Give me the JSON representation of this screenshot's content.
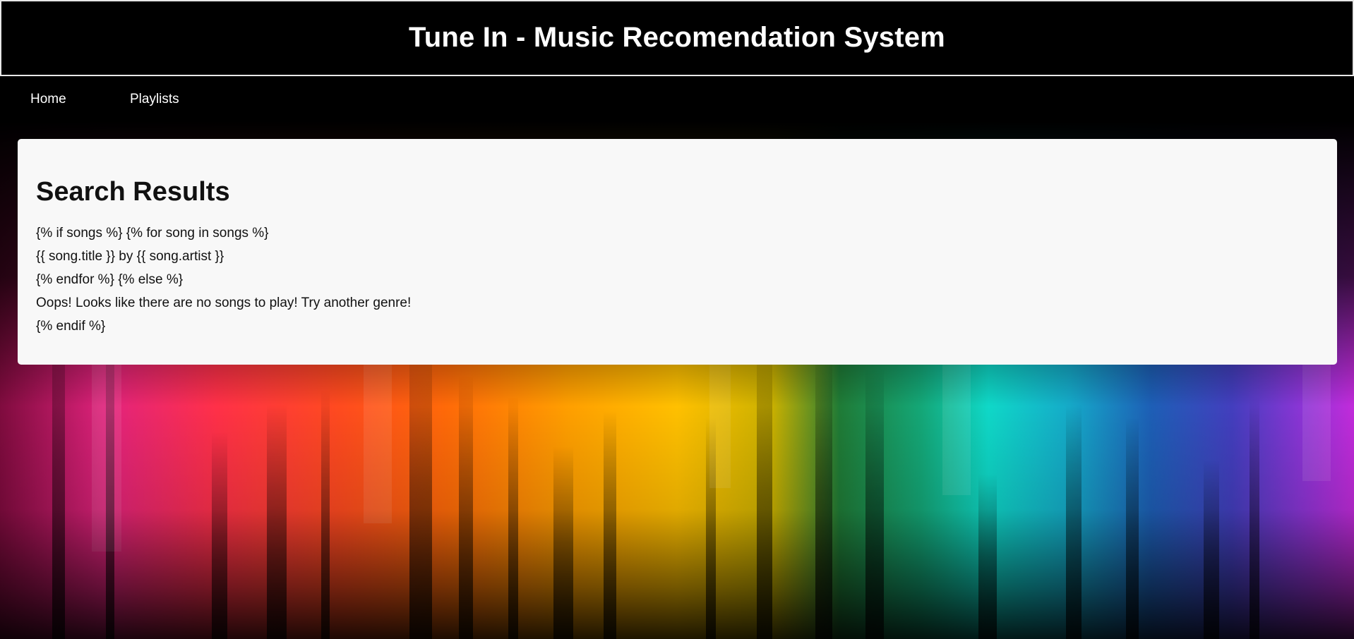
{
  "header": {
    "title": "Tune In - Music Recomendation System"
  },
  "nav": {
    "items": [
      {
        "label": "Home"
      },
      {
        "label": "Playlists"
      }
    ]
  },
  "main": {
    "heading": "Search Results",
    "lines": [
      "{% if songs %} {% for song in songs %}",
      "{{ song.title }} by {{ song.artist }}",
      "{% endfor %} {% else %}",
      "Oops! Looks like there are no songs to play! Try another genre!",
      "{% endif %}"
    ]
  },
  "colors": {
    "header_bg": "#000000",
    "header_text": "#ffffff",
    "card_bg": "#f8f8f8",
    "text": "#111111"
  }
}
